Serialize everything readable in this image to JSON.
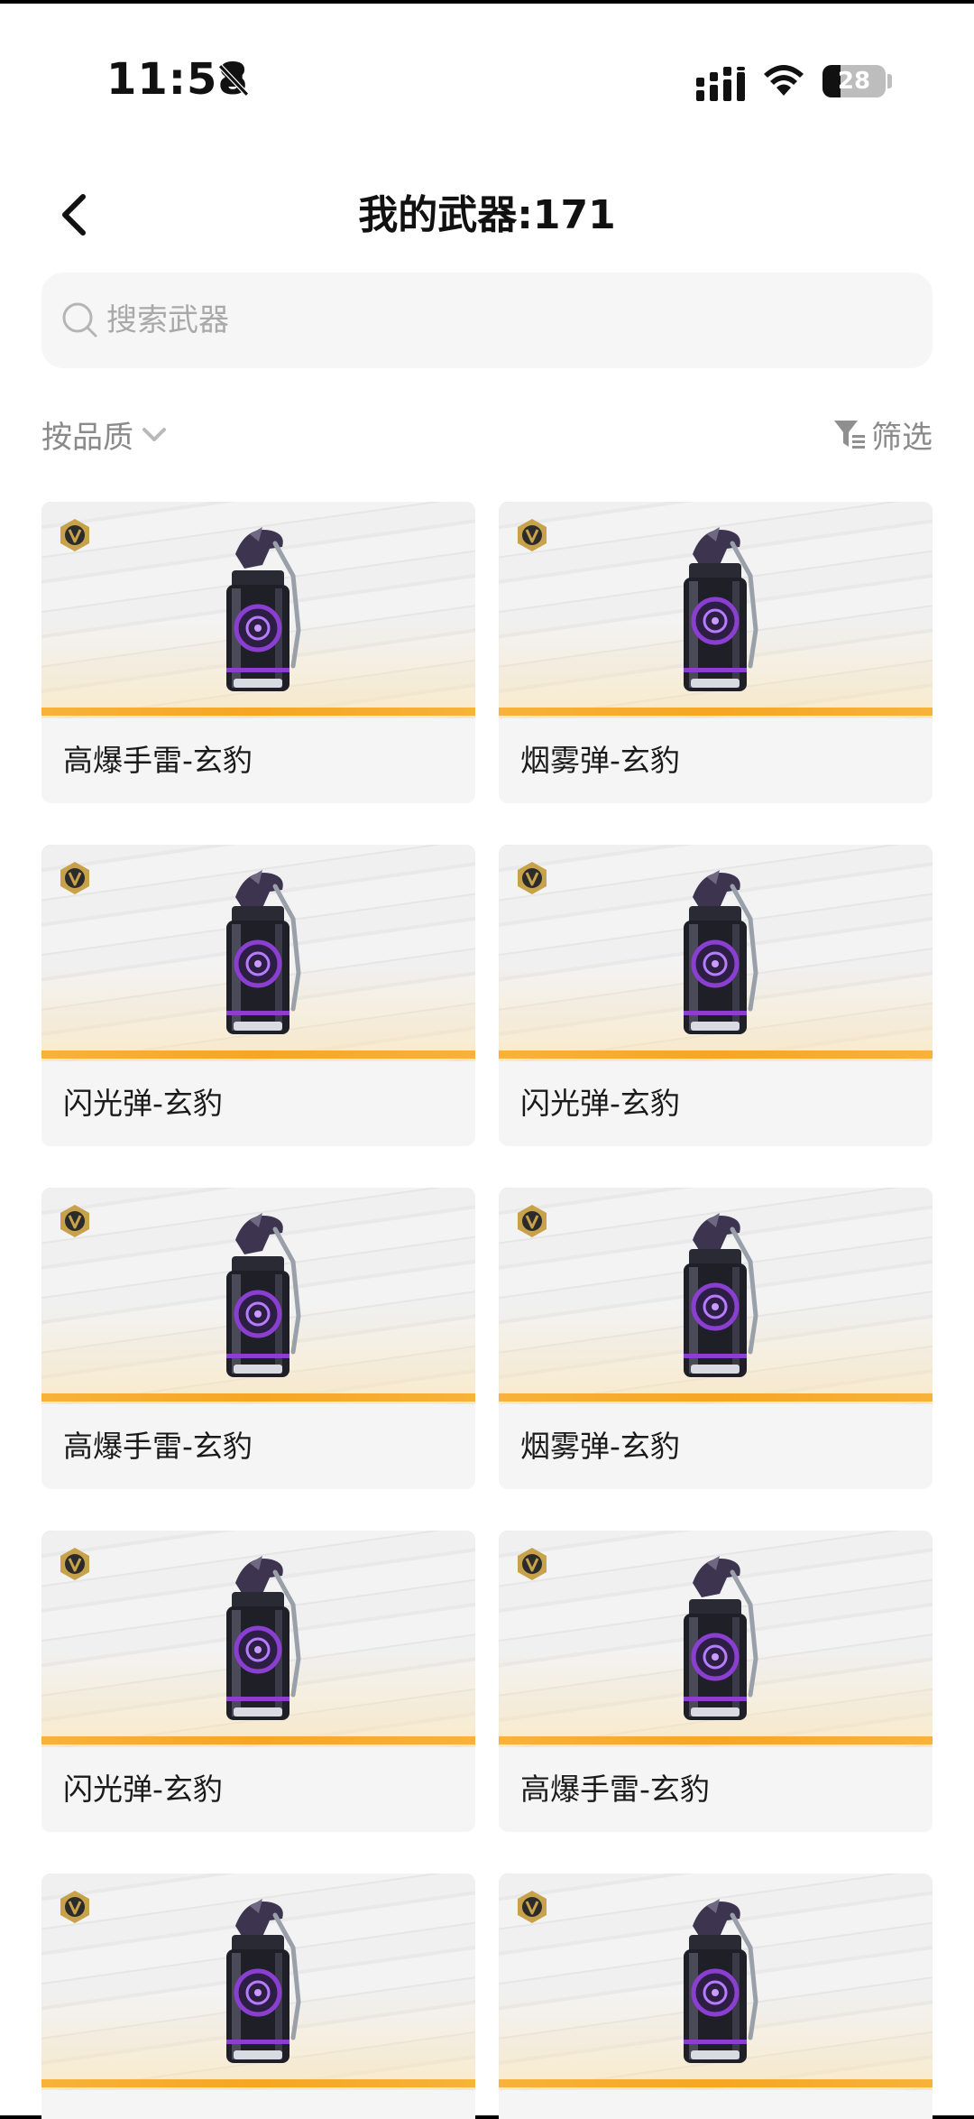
{
  "status_bar": {
    "time": "11:58",
    "battery": 28,
    "icons": [
      "bell-muted-icon",
      "signal-icon",
      "wifi-icon",
      "battery-icon"
    ]
  },
  "header": {
    "title": "我的武器:171"
  },
  "search": {
    "placeholder": "搜索武器"
  },
  "toolbar": {
    "sort_label": "按品质",
    "filter_label": "筛选"
  },
  "colors": {
    "accent_bar": "#f5a623",
    "badge_gold": "#c8a24a",
    "grenade_purple": "#8a3fd1"
  },
  "weapons": [
    {
      "name": "高爆手雷-玄豹",
      "type": "he"
    },
    {
      "name": "烟雾弹-玄豹",
      "type": "smoke"
    },
    {
      "name": "闪光弹-玄豹",
      "type": "flash"
    },
    {
      "name": "闪光弹-玄豹",
      "type": "flash"
    },
    {
      "name": "高爆手雷-玄豹",
      "type": "he"
    },
    {
      "name": "烟雾弹-玄豹",
      "type": "smoke"
    },
    {
      "name": "闪光弹-玄豹",
      "type": "flash"
    },
    {
      "name": "高爆手雷-玄豹",
      "type": "he"
    },
    {
      "name": "",
      "type": "flash"
    },
    {
      "name": "",
      "type": "smoke"
    }
  ]
}
